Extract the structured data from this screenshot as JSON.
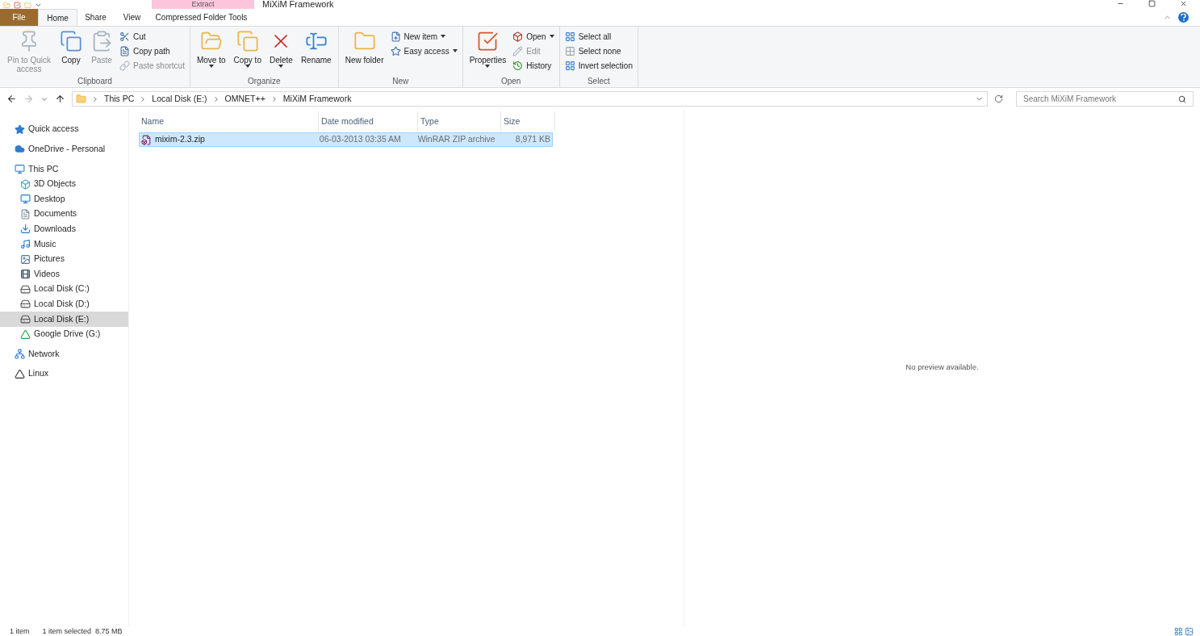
{
  "window": {
    "title": "MiXiM Framework",
    "context_tab": "Extract"
  },
  "tabs": [
    {
      "label": "File",
      "kind": "file",
      "selected": false
    },
    {
      "label": "Home",
      "kind": "tab",
      "selected": true
    },
    {
      "label": "Share",
      "kind": "tab",
      "selected": false
    },
    {
      "label": "View",
      "kind": "tab",
      "selected": false
    },
    {
      "label": "Compressed Folder Tools",
      "kind": "tab",
      "selected": false
    }
  ],
  "ribbon": [
    {
      "label": "Clipboard",
      "items": [
        {
          "kind": "large",
          "label": "Pin to Quick access",
          "disabled": true
        },
        {
          "kind": "large",
          "label": "Copy",
          "disabled": false
        },
        {
          "kind": "large",
          "label": "Paste",
          "disabled": true
        },
        {
          "kind": "stack",
          "children": [
            {
              "label": "Cut",
              "disabled": false
            },
            {
              "label": "Copy path",
              "disabled": false
            },
            {
              "label": "Paste shortcut",
              "disabled": true
            }
          ]
        }
      ]
    },
    {
      "label": "Organize",
      "items": [
        {
          "kind": "large",
          "label": "Move to",
          "dropdown": true,
          "disabled": false
        },
        {
          "kind": "large",
          "label": "Copy to",
          "dropdown": true,
          "disabled": false
        },
        {
          "kind": "large",
          "label": "Delete",
          "dropdown": true,
          "disabled": false
        },
        {
          "kind": "large",
          "label": "Rename",
          "disabled": false
        }
      ]
    },
    {
      "label": "New",
      "items": [
        {
          "kind": "large",
          "label": "New folder",
          "disabled": false
        },
        {
          "kind": "stack",
          "children": [
            {
              "label": "New item",
              "dropdown": true,
              "disabled": false
            },
            {
              "label": "Easy access",
              "dropdown": true,
              "disabled": false
            }
          ]
        }
      ]
    },
    {
      "label": "Open",
      "items": [
        {
          "kind": "large",
          "label": "Properties",
          "dropdown": true,
          "disabled": false
        },
        {
          "kind": "stack",
          "children": [
            {
              "label": "Open",
              "dropdown": true,
              "disabled": false
            },
            {
              "label": "Edit",
              "disabled": true
            },
            {
              "label": "History",
              "disabled": false
            }
          ]
        }
      ]
    },
    {
      "label": "Select",
      "items": [
        {
          "kind": "stack",
          "children": [
            {
              "label": "Select all",
              "disabled": false
            },
            {
              "label": "Select none",
              "disabled": false
            },
            {
              "label": "Invert selection",
              "disabled": false
            }
          ]
        }
      ]
    }
  ],
  "address": {
    "path": [
      "This PC",
      "Local Disk (E:)",
      "OMNET++",
      "MiXiM Framework"
    ],
    "search_placeholder": "Search MiXiM Framework"
  },
  "navigation": [
    {
      "label": "Quick access",
      "selected": false
    },
    {
      "label": "OneDrive - Personal",
      "selected": false
    },
    {
      "label": "This PC",
      "selected": false,
      "children": [
        {
          "label": "3D Objects",
          "selected": false
        },
        {
          "label": "Desktop",
          "selected": false
        },
        {
          "label": "Documents",
          "selected": false
        },
        {
          "label": "Downloads",
          "selected": false
        },
        {
          "label": "Music",
          "selected": false
        },
        {
          "label": "Pictures",
          "selected": false
        },
        {
          "label": "Videos",
          "selected": false
        },
        {
          "label": "Local Disk (C:)",
          "selected": false
        },
        {
          "label": "Local Disk (D:)",
          "selected": false
        },
        {
          "label": "Local Disk (E:)",
          "selected": true
        },
        {
          "label": "Google Drive (G:)",
          "selected": false
        }
      ]
    },
    {
      "label": "Network",
      "selected": false
    },
    {
      "label": "Linux",
      "selected": false
    }
  ],
  "files": {
    "columns": [
      "Name",
      "Date modified",
      "Type",
      "Size"
    ],
    "rows": [
      {
        "name": "mixim-2.3.zip",
        "date": "06-03-2013 03:35 AM",
        "type": "WinRAR ZIP archive",
        "size": "8,971 KB",
        "selected": true
      }
    ]
  },
  "preview": {
    "message": "No preview available."
  },
  "status_bar": {
    "count": "1 item",
    "selection": "1 item selected  8.75 MB"
  }
}
